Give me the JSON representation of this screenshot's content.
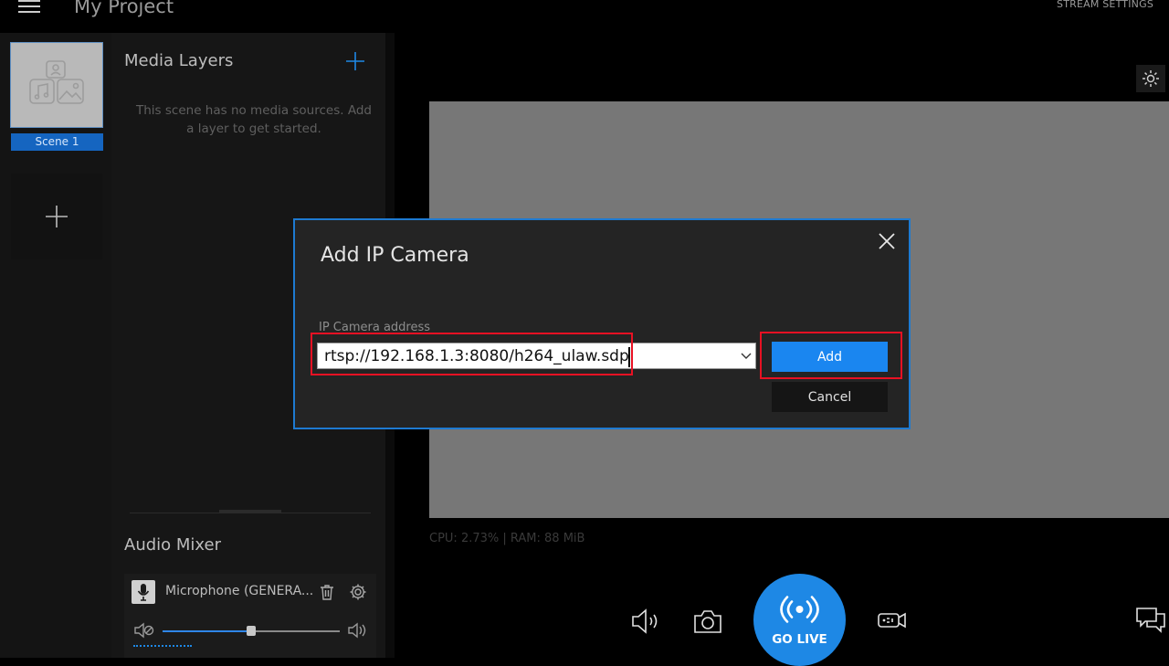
{
  "header": {
    "project_title": "My Project",
    "stream_settings": "STREAM SETTINGS"
  },
  "scenes": {
    "items": [
      {
        "label": "Scene 1",
        "selected": true
      }
    ]
  },
  "layers": {
    "title": "Media Layers",
    "empty_message": "This scene has no media sources. Add a layer to get started."
  },
  "audio_mixer": {
    "title": "Audio Mixer",
    "channels": [
      {
        "name": "Microphone  (GENERA...",
        "volume_fraction": 0.5
      }
    ]
  },
  "preview": {
    "stats": "CPU: 2.73% | RAM: 88 MiB"
  },
  "controls": {
    "go_live_label": "GO LIVE"
  },
  "dialog": {
    "title": "Add IP Camera",
    "field_label": "IP Camera address",
    "address_value": "rtsp://192.168.1.3:8080/h264_ulaw.sdp",
    "add_label": "Add",
    "cancel_label": "Cancel"
  },
  "colors": {
    "accent": "#1e88e5",
    "highlight": "#e81123",
    "background": "#000000"
  },
  "icons": [
    "menu-icon",
    "add-icon",
    "close-icon",
    "microphone-icon",
    "delete-icon",
    "settings-icon",
    "mute-icon",
    "volume-icon",
    "brightness-icon",
    "audio-icon",
    "camera-icon",
    "live-icon",
    "record-icon",
    "chat-icon",
    "chevron-down-icon",
    "media-placeholder-icon"
  ]
}
